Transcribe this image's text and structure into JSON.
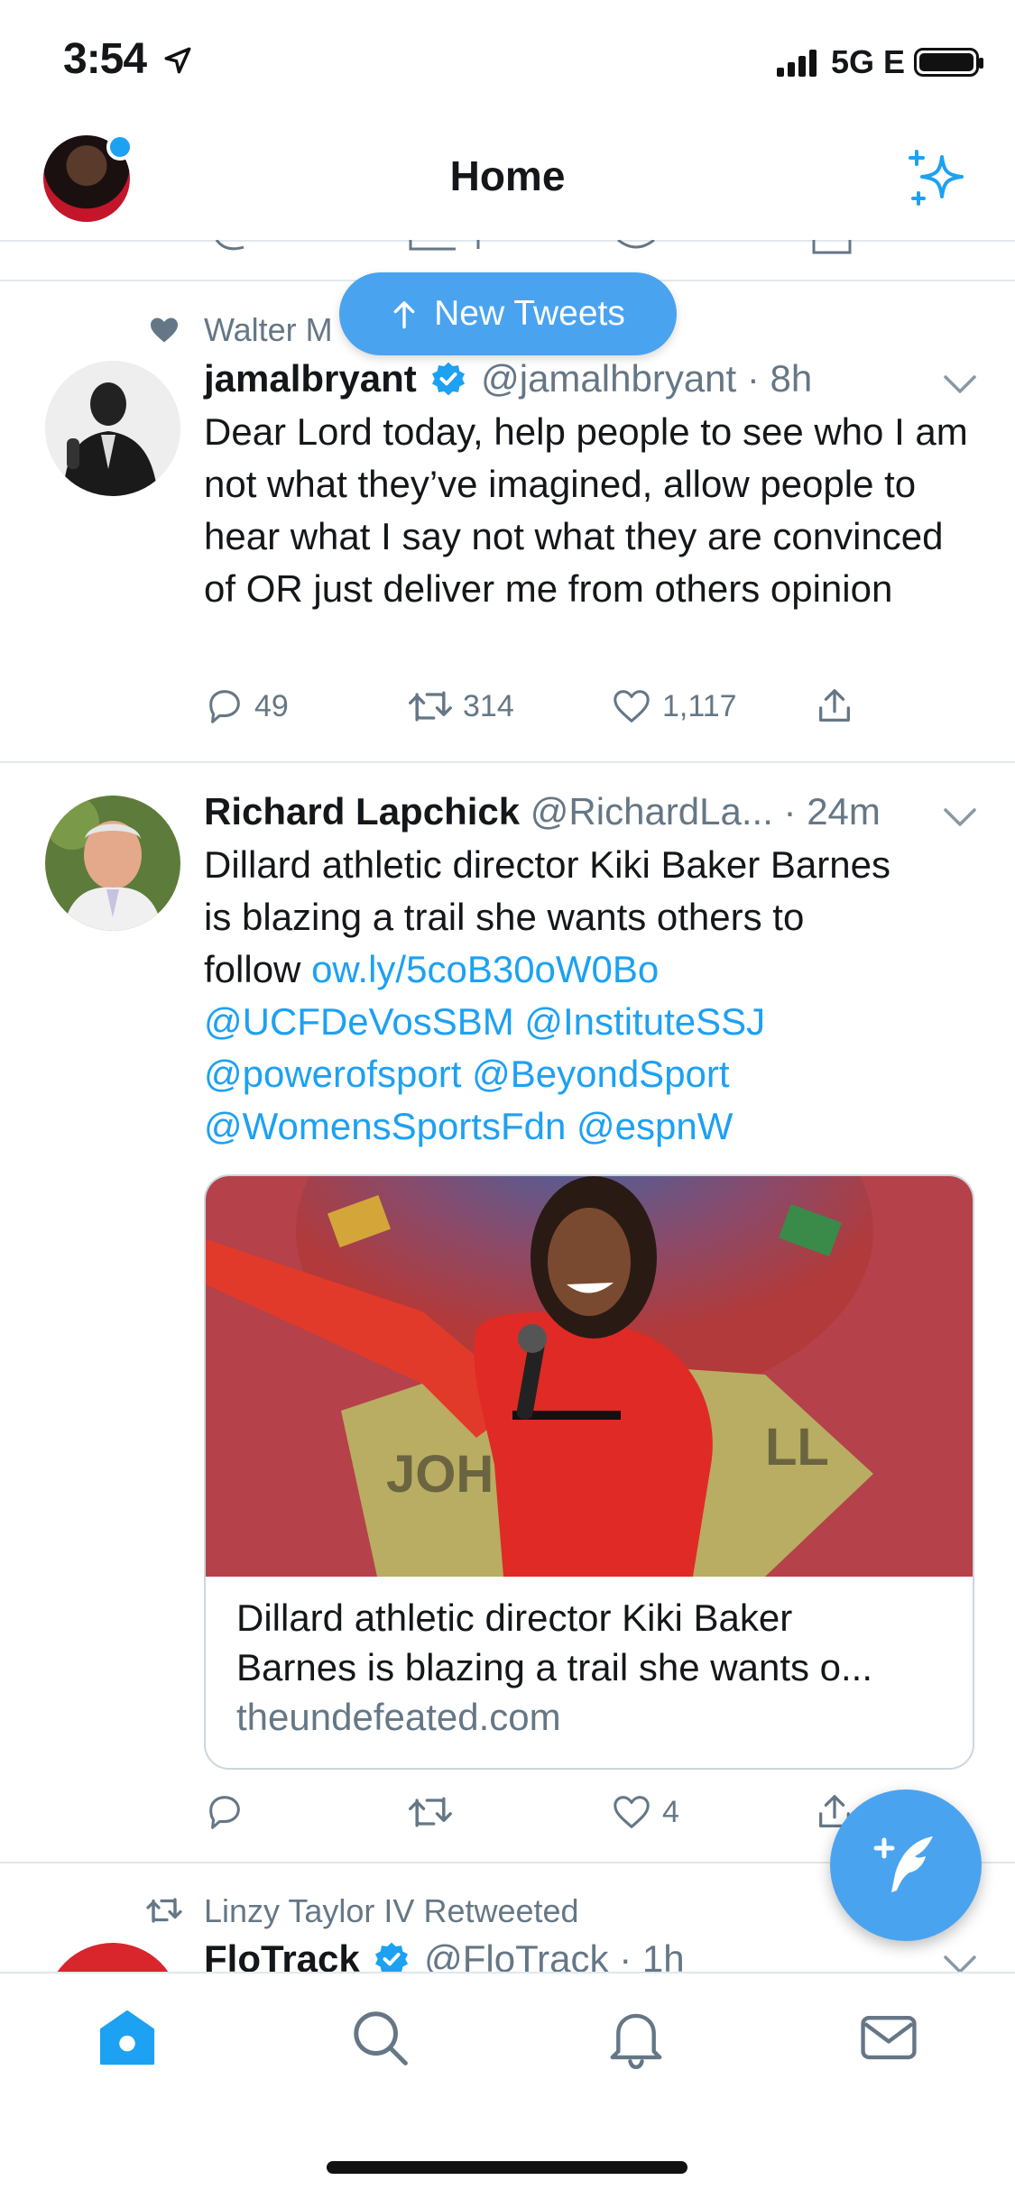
{
  "status_bar": {
    "time": "3:54",
    "network": "5G E",
    "icons": [
      "location-arrow-icon",
      "signal-bars-icon",
      "battery-icon"
    ]
  },
  "header": {
    "title": "Home",
    "left_icon": "profile-avatar",
    "right_icon": "sparkle-icon"
  },
  "new_tweets_pill": {
    "label": "New Tweets",
    "icon": "arrow-up-icon"
  },
  "tweets": [
    {
      "social_context": "Walter M",
      "context_icon": "heart-icon",
      "name": "jamalbryant",
      "verified": true,
      "handle": "@jamalhbryant",
      "time": "· 8h",
      "text": "Dear Lord today, help people to see who I am not what they’ve imagined, allow people to hear what I say not what they are convinced of OR just deliver me from others opinion",
      "replies": "49",
      "retweets": "314",
      "likes": "1,117"
    },
    {
      "name": "Richard Lapchick",
      "handle": "@RichardLa...",
      "time": "· 24m",
      "text_lines": [
        "Dillard athletic director Kiki Baker Barnes",
        "is blazing a trail she wants others to",
        "follow "
      ],
      "link": "ow.ly/5coB30oW0Bo",
      "mentions_line1": "@UCFDeVosSBM @InstituteSSJ",
      "mentions_line2": "@powerofsport @BeyondSport",
      "mentions_line3": "@WomensSportsFdn @espnW",
      "card": {
        "title_line1": "Dillard athletic director Kiki Baker",
        "title_line2": "Barnes is blazing a trail she wants o...",
        "domain": "theundefeated.com"
      },
      "replies": "",
      "retweets": "",
      "likes": "4"
    },
    {
      "social_context": "Linzy Taylor IV Retweeted",
      "context_icon": "retweet-icon",
      "name": "FloTrack",
      "verified": true,
      "handle": "@FloTrack",
      "time": "· 1h"
    }
  ],
  "tab_bar": {
    "tabs": [
      "home-icon",
      "search-icon",
      "bell-icon",
      "mail-icon"
    ],
    "active": "home-icon"
  },
  "colors": {
    "accent": "#1da1f2",
    "pill": "#4aa3ef",
    "secondary_text": "#657786",
    "divider": "#e1e8ed"
  }
}
